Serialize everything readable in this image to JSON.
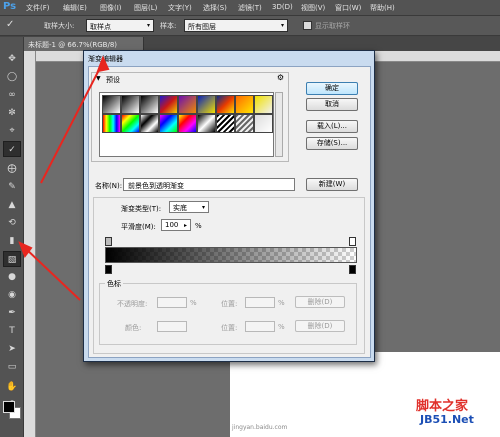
{
  "app": {
    "logo": "Ps",
    "menus": [
      "文件(F)",
      "编辑(E)",
      "图像(I)",
      "图层(L)",
      "文字(Y)",
      "选择(S)",
      "滤镜(T)",
      "3D(D)",
      "视图(V)",
      "窗口(W)",
      "帮助(H)"
    ]
  },
  "options": {
    "sample_size_label": "取样大小:",
    "sample_size_value": "取样点",
    "sample_label": "样本:",
    "sample_value": "所有图层",
    "show_ring_label": "显示取样环"
  },
  "document": {
    "tab_label": "未标题-1 @ 66.7%(RGB/8)"
  },
  "dialog": {
    "title": "渐变编辑器",
    "presets_label": "预设",
    "buttons": {
      "ok": "确定",
      "cancel": "取消",
      "load": "载入(L)...",
      "save": "存储(S)...",
      "new": "新建(W)"
    },
    "name_label": "名称(N):",
    "name_value": "前景色到透明渐变",
    "gradient_type_label": "渐变类型(T):",
    "gradient_type_value": "实底",
    "smoothness_label": "平滑度(M):",
    "smoothness_value": "100",
    "smoothness_unit": "%",
    "stops_title": "色标",
    "opacity_label": "不透明度:",
    "color_label": "颜色:",
    "location_label": "位置:",
    "percent": "%",
    "delete_label": "删除(D)"
  },
  "watermark": {
    "line1": "脚本之家",
    "line2": "JB51.Net",
    "line3": "jingyan.baidu.com"
  },
  "colors": {
    "annotation_arrow": "#e8261f",
    "dialog_frame": "#c9dbef",
    "default_button": "#bee6fd"
  },
  "icons": [
    "move-icon",
    "marquee-icon",
    "lasso-icon",
    "quick-select-icon",
    "crop-icon",
    "eyedropper-icon",
    "healing-icon",
    "brush-icon",
    "stamp-icon",
    "history-brush-icon",
    "eraser-icon",
    "gradient-icon",
    "blur-icon",
    "dodge-icon",
    "pen-icon",
    "type-icon",
    "path-select-icon",
    "shape-icon",
    "hand-icon",
    "zoom-icon",
    "gear-icon"
  ]
}
